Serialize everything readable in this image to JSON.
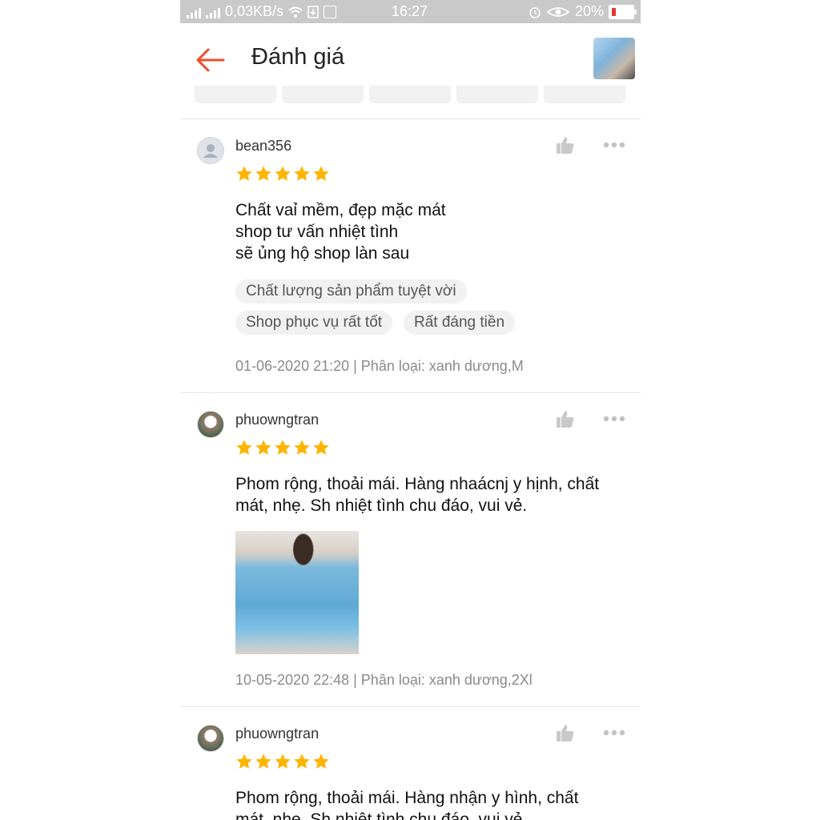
{
  "status_bar": {
    "network_speed": "0,03KB/s",
    "time": "16:27",
    "battery": "20%"
  },
  "header": {
    "title": "Đánh giá"
  },
  "filters": [
    "",
    "",
    "",
    "",
    ""
  ],
  "reviews": [
    {
      "username": "bean356",
      "rating": 5,
      "comment": "Chất vaỉ mềm, đẹp mặc mát\nshop tư vấn nhiệt tình\nsẽ ủng hộ shop làn sau",
      "tags": [
        "Chất lượng sản phẩm tuyệt vời",
        "Shop phục vụ rất tốt",
        "Rất đáng tiền"
      ],
      "meta": "01-06-2020 21:20 | Phân loại: xanh dương,M"
    },
    {
      "username": "phuowngtran",
      "rating": 5,
      "comment": "Phom rộng, thoải mái. Hàng nhaácnj y hịnh, chất\nmát, nhẹ. Sh nhiệt tình chu đáo, vui vẻ.",
      "meta": "10-05-2020 22:48 | Phân loại: xanh dương,2Xl"
    },
    {
      "username": "phuowngtran",
      "rating": 5,
      "comment": "Phom rộng, thoải mái. Hàng nhận y hình, chất\nmát, nhẹ. Sh nhiệt tình chu đáo, vui vẻ."
    }
  ],
  "colors": {
    "accent": "#ee4d2d",
    "star": "#ffb400",
    "status_bar": "#c9c9c9"
  },
  "icons": {
    "back": "arrow-left-icon",
    "like": "thumbs-up-icon",
    "more": "more-dots-icon",
    "star": "star-icon"
  }
}
